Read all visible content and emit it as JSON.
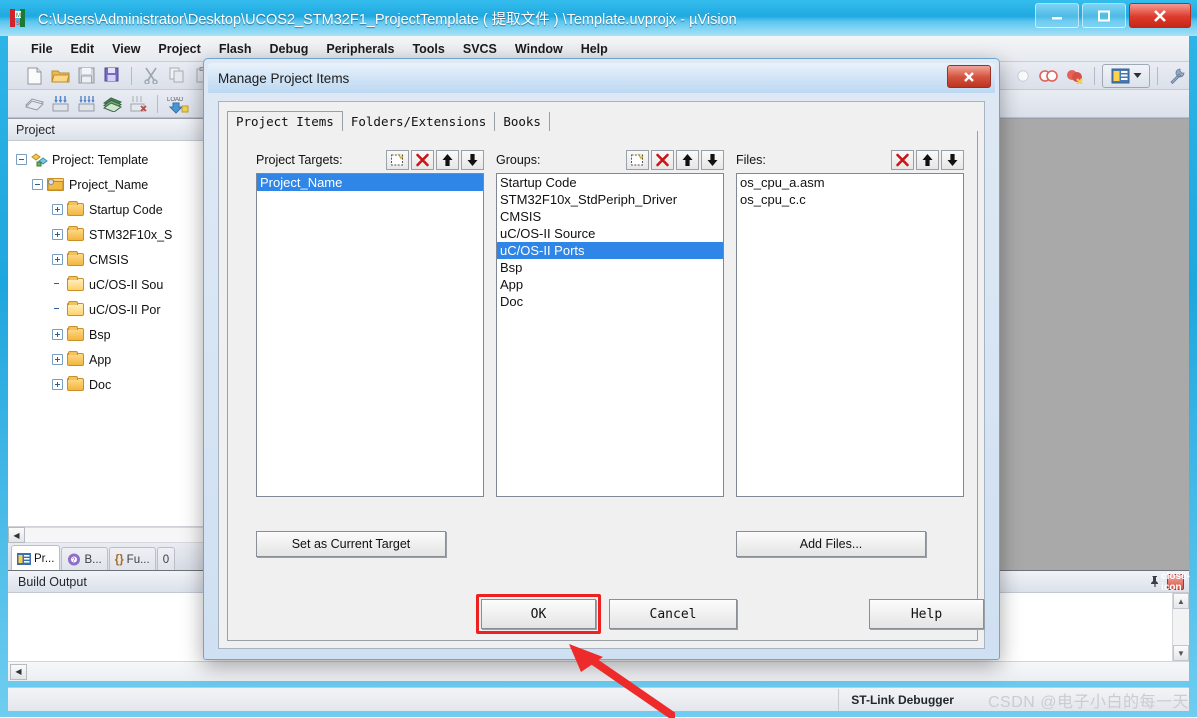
{
  "window": {
    "title": "C:\\Users\\Administrator\\Desktop\\UCOS2_STM32F1_ProjectTemplate ( 提取文件 ) \\Template.uvprojx - µVision",
    "app_icon": "keil-uvision-icon",
    "controls": {
      "minimize": "—",
      "maximize": "❐",
      "close": "✕"
    }
  },
  "menu": {
    "items": [
      {
        "label": "File"
      },
      {
        "label": "Edit"
      },
      {
        "label": "View"
      },
      {
        "label": "Project"
      },
      {
        "label": "Flash"
      },
      {
        "label": "Debug"
      },
      {
        "label": "Peripherals"
      },
      {
        "label": "Tools"
      },
      {
        "label": "SVCS"
      },
      {
        "label": "Window"
      },
      {
        "label": "Help"
      }
    ]
  },
  "toolbar_row1": {
    "icons": [
      "new-file-icon",
      "open-folder-icon",
      "save-icon",
      "save-all-icon",
      "cut-icon",
      "copy-icon",
      "paste-icon",
      "undo-icon",
      "redo-icon",
      "indent-icon",
      "outdent-icon",
      "comment-icon",
      "bookmark-icon",
      "find-icon",
      "find-next-icon",
      "target-options-icon",
      "debug-icon"
    ],
    "right_icons": [
      "breakpoint-icon",
      "insert-breakpoint-icon",
      "kill-breakpoints-icon",
      "project-window-icon",
      "chevron-down-icon",
      "configure-icon"
    ]
  },
  "toolbar_row2": {
    "icons": [
      "translate-icon",
      "build-icon",
      "rebuild-icon",
      "batch-build-icon",
      "stop-build-icon",
      "load-icon",
      "target-select-icon",
      "options-icon",
      "manage-icon"
    ]
  },
  "project_pane": {
    "header": "Project",
    "tree": [
      {
        "label": "Project: Template",
        "icon": "project-icon",
        "expander": "minus",
        "indent": 0
      },
      {
        "label": "Project_Name",
        "icon": "target-icon",
        "expander": "minus",
        "indent": 1
      },
      {
        "label": "Startup Code",
        "icon": "folder-icon",
        "expander": "plus",
        "indent": 2
      },
      {
        "label": "STM32F10x_S",
        "icon": "folder-icon",
        "expander": "plus",
        "indent": 2
      },
      {
        "label": "CMSIS",
        "icon": "folder-icon",
        "expander": "plus",
        "indent": 2
      },
      {
        "label": "uC/OS-II Sou",
        "icon": "folder-open-icon",
        "expander": "none",
        "indent": 2
      },
      {
        "label": "uC/OS-II Por",
        "icon": "folder-open-icon",
        "expander": "none",
        "indent": 2
      },
      {
        "label": "Bsp",
        "icon": "folder-icon",
        "expander": "plus",
        "indent": 2
      },
      {
        "label": "App",
        "icon": "folder-icon",
        "expander": "plus",
        "indent": 2
      },
      {
        "label": "Doc",
        "icon": "folder-icon",
        "expander": "plus",
        "indent": 2
      }
    ],
    "tabs": [
      {
        "label": "Pr...",
        "icon": "project-tab-icon",
        "active": true
      },
      {
        "label": "B...",
        "icon": "books-tab-icon",
        "active": false
      },
      {
        "label": "Fu...",
        "icon": "functions-tab-icon",
        "prefix": "{}",
        "active": false
      },
      {
        "label": "",
        "icon": "templates-tab-icon",
        "prefix": "0",
        "active": false
      }
    ],
    "hscroll_left_arrow": "◀"
  },
  "build_output": {
    "header": "Build Output",
    "pin_icon": "pin-icon",
    "close_icon": "close-icon",
    "scroll_up": "▲",
    "scroll_down": "▼",
    "hscroll_left": "◀"
  },
  "statusbar": {
    "debugger": "ST-Link Debugger",
    "watermark": "CSDN @电子小白的每一天"
  },
  "dialog": {
    "title": "Manage Project Items",
    "close_label": "✕",
    "tabs": [
      {
        "label": "Project Items",
        "active": true
      },
      {
        "label": "Folders/Extensions",
        "active": false
      },
      {
        "label": "Books",
        "active": false
      }
    ],
    "project_targets": {
      "label": "Project Targets:",
      "buttons": [
        "new-item-icon",
        "delete-icon",
        "move-up-icon",
        "move-down-icon"
      ],
      "items": [
        {
          "label": "Project_Name",
          "selected": true
        }
      ]
    },
    "groups": {
      "label": "Groups:",
      "buttons": [
        "new-item-icon",
        "delete-icon",
        "move-up-icon",
        "move-down-icon"
      ],
      "items": [
        {
          "label": "Startup Code",
          "selected": false
        },
        {
          "label": "STM32F10x_StdPeriph_Driver",
          "selected": false
        },
        {
          "label": "CMSIS",
          "selected": false
        },
        {
          "label": "uC/OS-II Source",
          "selected": false
        },
        {
          "label": "uC/OS-II Ports",
          "selected": true
        },
        {
          "label": "Bsp",
          "selected": false
        },
        {
          "label": "App",
          "selected": false
        },
        {
          "label": "Doc",
          "selected": false
        }
      ]
    },
    "files": {
      "label": "Files:",
      "buttons": [
        "delete-icon",
        "move-up-icon",
        "move-down-icon"
      ],
      "items": [
        {
          "label": "os_cpu_a.asm",
          "selected": false
        },
        {
          "label": "os_cpu_c.c",
          "selected": false
        }
      ]
    },
    "set_current_target_label": "Set as Current Target",
    "add_files_label": "Add Files...",
    "ok_label": "OK",
    "cancel_label": "Cancel",
    "help_label": "Help"
  },
  "annotations": {
    "ok_highlight_color": "#ef2020",
    "arrow_color": "#ee2b2b"
  },
  "colors": {
    "title_blue": "#1fa9e0",
    "selection_blue": "#2f86e6",
    "mdi_gray": "#a9a9a9",
    "dialog_face": "#f0f0f0"
  }
}
